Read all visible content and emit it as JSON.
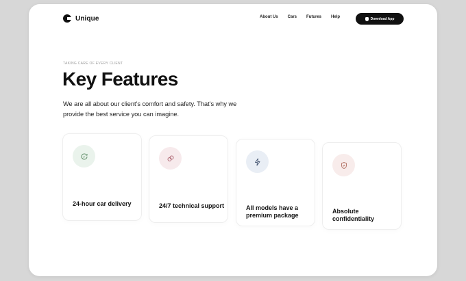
{
  "brand": {
    "name": "Unique",
    "logo_icon": "c-shape-logo-icon"
  },
  "nav": {
    "items": [
      {
        "label": "About Us"
      },
      {
        "label": "Cars"
      },
      {
        "label": "Futures"
      },
      {
        "label": "Help"
      }
    ],
    "download_label": "Download App",
    "download_icon": "apple-icon"
  },
  "hero": {
    "eyebrow": "TAKING CARE OF EVERY CLIENT",
    "title": "Key Features",
    "description": "We are all about our client's comfort and safety. That's why we provide the best service you can imagine."
  },
  "features": [
    {
      "label": "24-hour car delivery",
      "icon": "clock-24-icon",
      "icon_bg": "#eaf3ec",
      "icon_color": "#5f8d68"
    },
    {
      "label": "24/7 technical support",
      "icon": "support-icon",
      "icon_bg": "#f7eaec",
      "icon_color": "#b06a76"
    },
    {
      "label": "All models have a premium package",
      "icon": "lightning-icon",
      "icon_bg": "#e9eef5",
      "icon_color": "#4f5f7a"
    },
    {
      "label": "Absolute confidentiality",
      "icon": "shield-icon",
      "icon_bg": "#f8eceb",
      "icon_color": "#b87a6e"
    }
  ],
  "colors": {
    "page_bg": "#d7d7d7",
    "card_bg": "#ffffff",
    "accent_dark": "#111111"
  }
}
